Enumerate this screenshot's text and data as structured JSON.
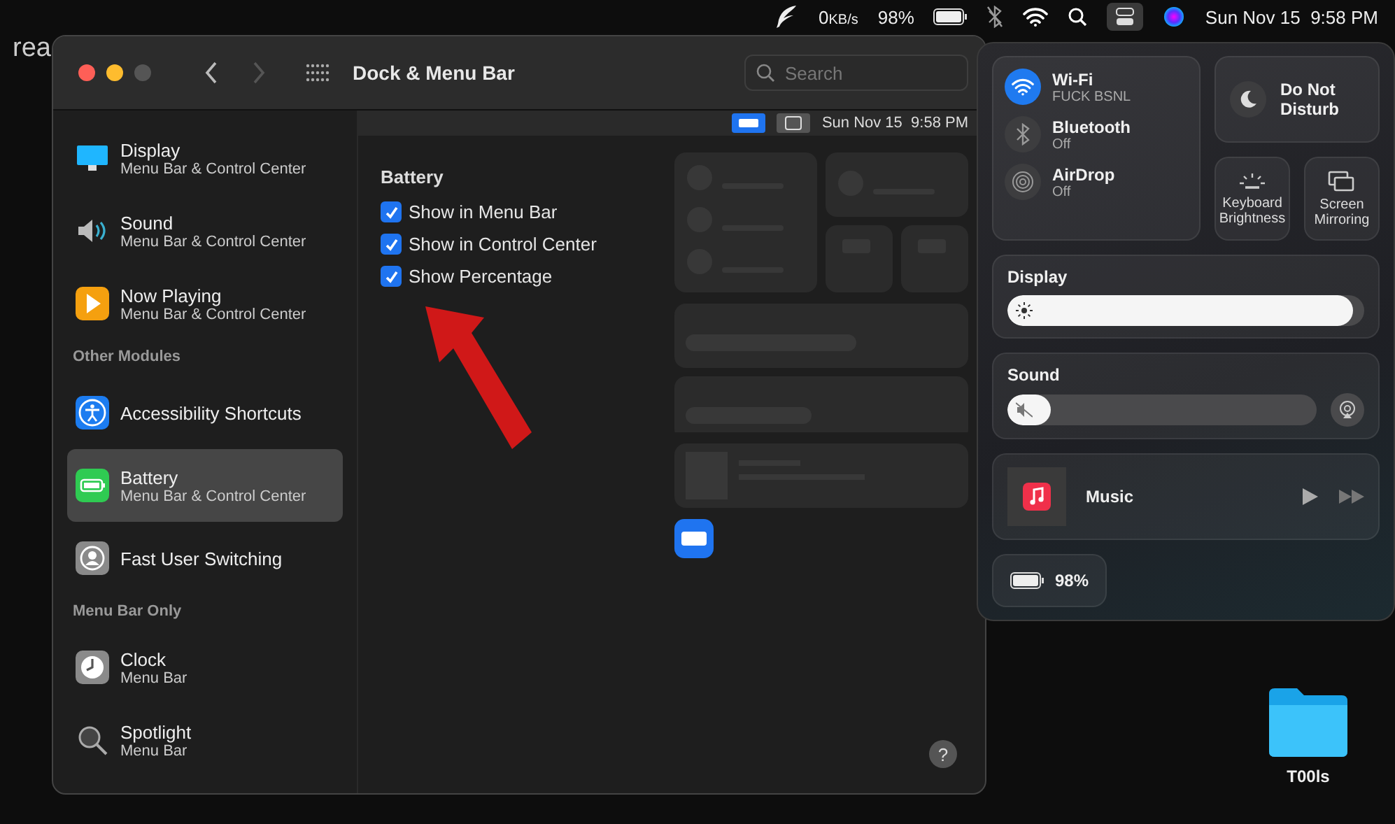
{
  "menu_bar": {
    "net_speed": "0",
    "net_unit": "KB/s",
    "battery_percent": "98%",
    "clock": "Sun Nov 15  9:58 PM"
  },
  "desktop": {
    "texts": [
      "rea"
    ],
    "folder": {
      "label": "T00ls"
    }
  },
  "window": {
    "title": "Dock & Menu Bar",
    "search": {
      "placeholder": "Search"
    },
    "sidebar": [
      {
        "kind": "display",
        "title": "Display",
        "subtitle": "Menu Bar & Control Center",
        "selected": false
      },
      {
        "kind": "sound",
        "title": "Sound",
        "subtitle": "Menu Bar & Control Center",
        "selected": false
      },
      {
        "kind": "now_playing",
        "title": "Now Playing",
        "subtitle": "Menu Bar & Control Center",
        "selected": false
      },
      {
        "kind": "header",
        "title": "Other Modules"
      },
      {
        "kind": "accessibility",
        "title": "Accessibility Shortcuts",
        "selected": false
      },
      {
        "kind": "battery",
        "title": "Battery",
        "subtitle": "Menu Bar & Control Center",
        "selected": true
      },
      {
        "kind": "user_switching",
        "title": "Fast User Switching",
        "selected": false
      },
      {
        "kind": "header",
        "title": "Menu Bar Only"
      },
      {
        "kind": "clock",
        "title": "Clock",
        "subtitle": "Menu Bar",
        "selected": false
      },
      {
        "kind": "spotlight",
        "title": "Spotlight",
        "subtitle": "Menu Bar",
        "selected": false
      }
    ],
    "panel": {
      "heading": "Battery",
      "options": [
        {
          "label": "Show in Menu Bar",
          "checked": true
        },
        {
          "label": "Show in Control Center",
          "checked": true
        },
        {
          "label": "Show Percentage",
          "checked": true
        }
      ],
      "preview_clock": "Sun Nov 15  9:58 PM",
      "help": "?"
    }
  },
  "control_center": {
    "connectivity": [
      {
        "kind": "wifi",
        "label": "Wi-Fi",
        "status": "FUCK BSNL",
        "on": true
      },
      {
        "kind": "bluetooth",
        "label": "Bluetooth",
        "status": "Off",
        "on": false
      },
      {
        "kind": "airdrop",
        "label": "AirDrop",
        "status": "Off",
        "on": false
      }
    ],
    "dnd": {
      "label": "Do Not Disturb",
      "on": false
    },
    "keyboard_brightness": "Keyboard Brightness",
    "screen_mirroring": "Screen Mirroring",
    "display": {
      "label": "Display",
      "level": 0.97
    },
    "sound": {
      "label": "Sound",
      "level": 0.04
    },
    "music": {
      "title": "Music"
    },
    "battery": "98%"
  }
}
